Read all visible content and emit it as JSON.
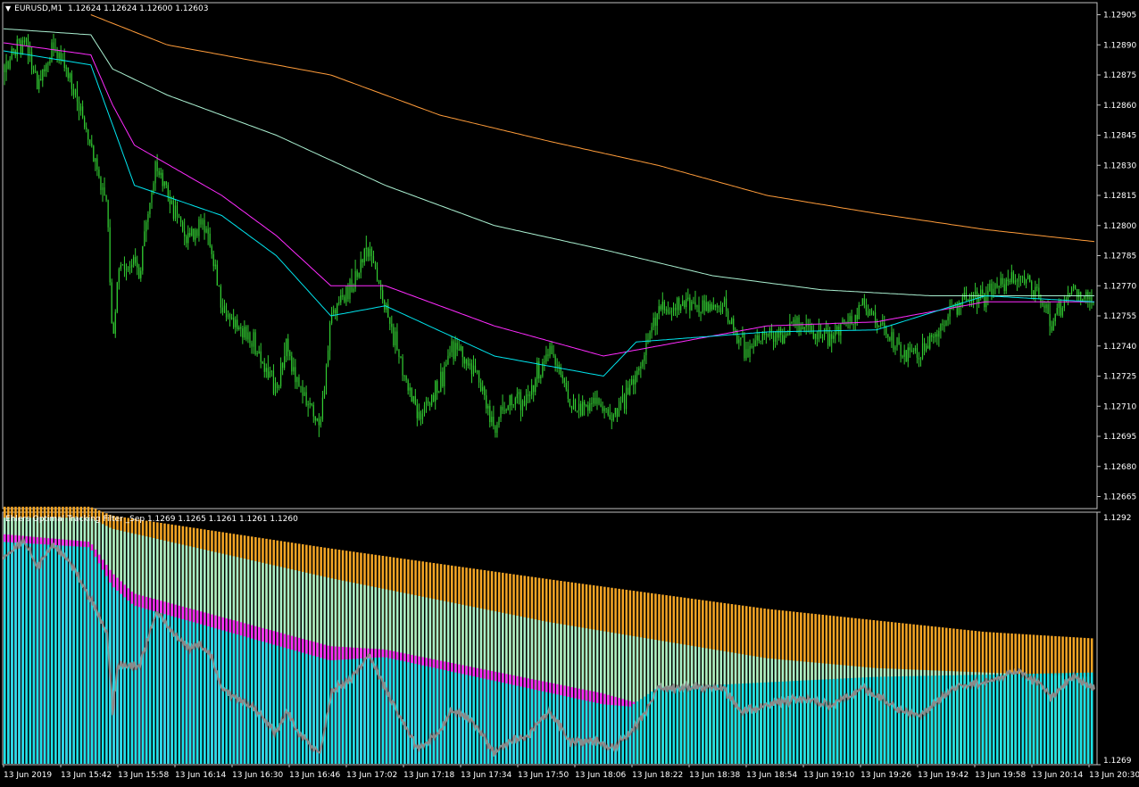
{
  "main_pane": {
    "symbol": "EURUSD,M1",
    "ohlc": "1.12624 1.12624 1.12600 1.12603"
  },
  "indicator_pane": {
    "title": "Ehlers Optimal Tracking Filter _Sep 1.1269 1.1265 1.1261 1.1261 1.1260"
  },
  "colors": {
    "background": "#000000",
    "frame": "#c0c0c0",
    "candle": "#32cd32",
    "ma_orange": "#ff9c3a",
    "ma_lightcyan": "#aaf0d1",
    "ma_magenta": "#ff2bff",
    "ma_cyan": "#00e5ee",
    "hist_orange": "#f5a524",
    "hist_mint": "#a8f0c8",
    "hist_magenta": "#ff2bff",
    "hist_cyan": "#19e3e8",
    "hist_price_line": "#8a8a8a"
  },
  "chart_data": [
    {
      "type": "candlestick",
      "title": "EURUSD,M1",
      "y_axis_ticks": [
        "1.12905",
        "1.12890",
        "1.12875",
        "1.12860",
        "1.12845",
        "1.12830",
        "1.12815",
        "1.12800",
        "1.12785",
        "1.12770",
        "1.12755",
        "1.12740",
        "1.12725",
        "1.12710",
        "1.12695",
        "1.12680",
        "1.12665"
      ],
      "ylim": [
        1.12659,
        1.12911
      ],
      "grid": false,
      "price_path": {
        "x_fraction": [
          0,
          0.02,
          0.03,
          0.045,
          0.06,
          0.075,
          0.09,
          0.095,
          0.1,
          0.105,
          0.125,
          0.14,
          0.155,
          0.17,
          0.18,
          0.19,
          0.2,
          0.23,
          0.25,
          0.26,
          0.27,
          0.29,
          0.3,
          0.32,
          0.335,
          0.35,
          0.365,
          0.38,
          0.4,
          0.41,
          0.43,
          0.45,
          0.46,
          0.48,
          0.5,
          0.52,
          0.54,
          0.56,
          0.58,
          0.6,
          0.63,
          0.66,
          0.675,
          0.69,
          0.7,
          0.73,
          0.76,
          0.79,
          0.82,
          0.84,
          0.87,
          0.9,
          0.93,
          0.95,
          0.96,
          0.98,
          0.99,
          1.0
        ],
        "close": [
          1.1288,
          1.12893,
          1.1287,
          1.1289,
          1.12875,
          1.1285,
          1.1282,
          1.1281,
          1.1274,
          1.1278,
          1.1278,
          1.1283,
          1.1281,
          1.12795,
          1.128,
          1.1279,
          1.1276,
          1.1274,
          1.1272,
          1.1274,
          1.1272,
          1.127,
          1.12755,
          1.1277,
          1.1279,
          1.1276,
          1.1273,
          1.12705,
          1.1272,
          1.1274,
          1.1273,
          1.127,
          1.1271,
          1.12715,
          1.1274,
          1.1271,
          1.12712,
          1.12705,
          1.12725,
          1.1276,
          1.1276,
          1.1276,
          1.1274,
          1.1274,
          1.12745,
          1.1275,
          1.12745,
          1.1276,
          1.1274,
          1.12735,
          1.1276,
          1.12765,
          1.12775,
          1.12765,
          1.1275,
          1.1277,
          1.12765,
          1.1276
        ]
      },
      "series": [
        {
          "indicator": "ma_orange",
          "x_fraction": [
            0.08,
            0.15,
            0.3,
            0.4,
            0.5,
            0.6,
            0.7,
            0.8,
            0.9,
            1.0
          ],
          "values": [
            1.12905,
            1.1289,
            1.12875,
            1.12855,
            1.12842,
            1.1283,
            1.12815,
            1.12806,
            1.12798,
            1.12792
          ]
        },
        {
          "indicator": "ma_lightcyan",
          "x_fraction": [
            0,
            0.08,
            0.1,
            0.15,
            0.25,
            0.35,
            0.45,
            0.55,
            0.65,
            0.75,
            0.85,
            0.95,
            1.0
          ],
          "values": [
            1.12898,
            1.12895,
            1.12878,
            1.12865,
            1.12845,
            1.1282,
            1.128,
            1.12788,
            1.12775,
            1.12768,
            1.12765,
            1.12765,
            1.12765
          ]
        },
        {
          "indicator": "ma_magenta",
          "x_fraction": [
            0,
            0.08,
            0.1,
            0.12,
            0.2,
            0.25,
            0.3,
            0.35,
            0.45,
            0.55,
            0.6,
            0.7,
            0.8,
            0.9,
            1.0
          ],
          "values": [
            1.12891,
            1.12885,
            1.1286,
            1.1284,
            1.12815,
            1.12795,
            1.1277,
            1.1277,
            1.1275,
            1.12735,
            1.1274,
            1.1275,
            1.12752,
            1.12762,
            1.12762
          ]
        },
        {
          "indicator": "ma_cyan",
          "x_fraction": [
            0,
            0.08,
            0.1,
            0.12,
            0.2,
            0.25,
            0.3,
            0.35,
            0.45,
            0.55,
            0.58,
            0.7,
            0.8,
            0.9,
            1.0
          ],
          "values": [
            1.12887,
            1.1288,
            1.1285,
            1.1282,
            1.12805,
            1.12785,
            1.12755,
            1.1276,
            1.12735,
            1.12725,
            1.12742,
            1.12747,
            1.12748,
            1.12765,
            1.12762
          ]
        }
      ],
      "x_tick_labels": [
        "13 Jun 2019",
        "13 Jun 15:42",
        "13 Jun 15:58",
        "13 Jun 16:14",
        "13 Jun 16:30",
        "13 Jun 16:46",
        "13 Jun 17:02",
        "13 Jun 17:18",
        "13 Jun 17:34",
        "13 Jun 17:50",
        "13 Jun 18:06",
        "13 Jun 18:22",
        "13 Jun 18:38",
        "13 Jun 18:54",
        "13 Jun 19:10",
        "13 Jun 19:26",
        "13 Jun 19:42",
        "13 Jun 19:58",
        "13 Jun 20:14",
        "13 Jun 20:30"
      ]
    },
    {
      "type": "bar",
      "title": "Ehlers Optimal Tracking Filter _Sep",
      "stacked_levels": true,
      "y_axis_ticks": [
        "1.1292",
        "1.1269"
      ],
      "ylim": [
        1.1269,
        1.1292
      ],
      "series": [
        {
          "indicator": "hist_orange",
          "x_fraction": [
            0,
            0.08,
            0.1,
            0.3,
            0.5,
            0.7,
            0.9,
            1.0
          ],
          "values": [
            1.12925,
            1.12925,
            1.12917,
            1.12887,
            1.12859,
            1.12832,
            1.12811,
            1.12805
          ]
        },
        {
          "indicator": "hist_mint",
          "x_fraction": [
            0,
            0.08,
            0.1,
            0.3,
            0.5,
            0.7,
            0.8,
            1.0
          ],
          "values": [
            1.12915,
            1.12915,
            1.12905,
            1.1286,
            1.1282,
            1.12787,
            1.12778,
            1.1277
          ]
        },
        {
          "indicator": "hist_magenta",
          "x_fraction": [
            0,
            0.08,
            0.1,
            0.12,
            0.3,
            0.35,
            0.55,
            0.575,
            0.6,
            1.0
          ],
          "values": [
            1.129,
            1.12893,
            1.12865,
            1.12846,
            1.12798,
            1.12795,
            1.12755,
            1.12748,
            1.12742,
            1.12742
          ]
        },
        {
          "indicator": "hist_cyan",
          "x_fraction": [
            0,
            0.08,
            0.1,
            0.12,
            0.3,
            0.35,
            0.55,
            0.575,
            0.6,
            0.8,
            1.0
          ],
          "values": [
            1.12893,
            1.12888,
            1.12853,
            1.12835,
            1.12785,
            1.12788,
            1.12745,
            1.12743,
            1.1276,
            1.1277,
            1.12774
          ]
        },
        {
          "indicator": "hist_price_line",
          "x_fraction": [
            0,
            0.02,
            0.03,
            0.045,
            0.06,
            0.075,
            0.09,
            0.095,
            0.1,
            0.105,
            0.125,
            0.14,
            0.155,
            0.17,
            0.18,
            0.19,
            0.2,
            0.23,
            0.25,
            0.26,
            0.27,
            0.29,
            0.3,
            0.32,
            0.335,
            0.35,
            0.365,
            0.38,
            0.4,
            0.41,
            0.43,
            0.45,
            0.46,
            0.48,
            0.5,
            0.52,
            0.54,
            0.56,
            0.58,
            0.6,
            0.63,
            0.66,
            0.675,
            0.69,
            0.7,
            0.73,
            0.76,
            0.79,
            0.82,
            0.84,
            0.87,
            0.9,
            0.93,
            0.95,
            0.96,
            0.98,
            0.99,
            1.0
          ],
          "values": [
            1.1288,
            1.12893,
            1.1287,
            1.1289,
            1.12875,
            1.1285,
            1.1282,
            1.1281,
            1.1274,
            1.1278,
            1.1278,
            1.1283,
            1.1281,
            1.12795,
            1.128,
            1.1279,
            1.1276,
            1.1274,
            1.1272,
            1.1274,
            1.1272,
            1.127,
            1.12755,
            1.1277,
            1.1279,
            1.1276,
            1.1273,
            1.12705,
            1.1272,
            1.1274,
            1.1273,
            1.127,
            1.1271,
            1.12715,
            1.1274,
            1.1271,
            1.12712,
            1.12705,
            1.12725,
            1.1276,
            1.1276,
            1.1276,
            1.1274,
            1.1274,
            1.12745,
            1.1275,
            1.12745,
            1.1276,
            1.1274,
            1.12735,
            1.1276,
            1.12765,
            1.12775,
            1.12765,
            1.1275,
            1.1277,
            1.12765,
            1.1276
          ]
        }
      ]
    }
  ]
}
